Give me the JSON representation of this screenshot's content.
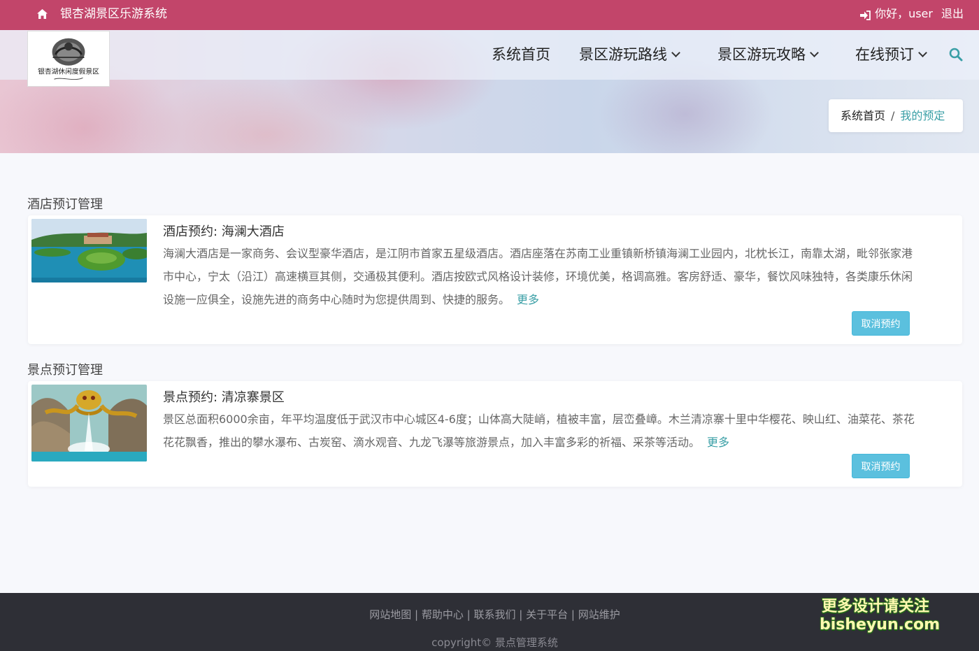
{
  "topbar": {
    "site_title": "银杏湖景区乐游系统",
    "greeting": "你好，user",
    "logout": "退出"
  },
  "logo": {
    "text": "银杏湖休闲度假景区"
  },
  "nav": {
    "items": [
      {
        "label": "系统首页"
      },
      {
        "label": "景区游玩路线"
      },
      {
        "label": "景区游玩攻略"
      },
      {
        "label": "在线预订"
      }
    ]
  },
  "breadcrumb": {
    "home": "系统首页",
    "separator": "/",
    "current": "我的预定"
  },
  "sections": [
    {
      "title": "酒店预订管理",
      "item": {
        "title": "酒店预约: 海澜大酒店",
        "description": "海澜大酒店是一家商务、会议型豪华酒店，是江阴市首家五星级酒店。酒店座落在苏南工业重镇新桥镇海澜工业园内，北枕长江，南靠太湖，毗邻张家港市中心，宁太（沿江）高速横亘其侧，交通极其便利。酒店按欧式风格设计装修，环境优美，格调高雅。客房舒适、豪华，餐饮风味独特，各类康乐休闲设施一应俱全，设施先进的商务中心随时为您提供周到、快捷的服务。",
        "more": "更多",
        "button": "取消预约"
      }
    },
    {
      "title": "景点预订管理",
      "item": {
        "title": "景点预约: 清凉寨景区",
        "description": "景区总面积6000余亩，年平均温度低于武汉市中心城区4-6度；山体高大陡峭，植被丰富，层峦叠嶂。木兰清凉寨十里中华樱花、映山红、油菜花、茶花花花飘香，推出的攀水瀑布、古炭窑、滴水观音、九龙飞瀑等旅游景点，加入丰富多彩的祈福、采茶等活动。",
        "more": "更多",
        "button": "取消预约"
      }
    }
  ],
  "footer": {
    "links": [
      "网站地图",
      "帮助中心",
      "联系我们",
      "关于平台",
      "网站维护"
    ],
    "separator": "|",
    "copyright": "copyright© 景点管理系统"
  },
  "watermark": {
    "line1": "更多设计请关注",
    "line2": "bisheyun.com"
  },
  "colors": {
    "topbar": "#c2456a",
    "accent": "#3a9fa6",
    "button": "#5bc0de",
    "footer": "#2e2f36"
  }
}
